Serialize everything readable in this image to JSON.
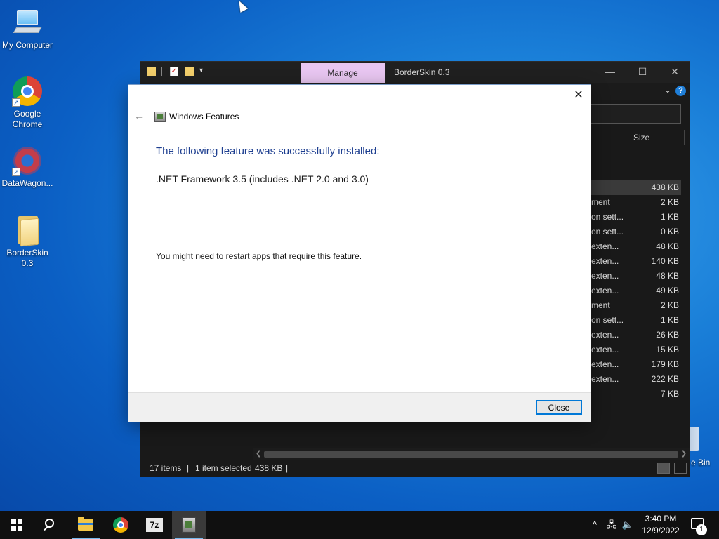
{
  "desktop": {
    "icons": [
      {
        "label": "My Computer",
        "icon": "computer-icon"
      },
      {
        "label": "Google Chrome",
        "icon": "chrome-icon"
      },
      {
        "label": "DataWagon...",
        "icon": "datawagon-icon"
      },
      {
        "label": "BorderSkin 0.3",
        "icon": "folder-icon"
      }
    ],
    "recycle_bin_label": "e Bin"
  },
  "explorer": {
    "manage_tab": "Manage",
    "title": "BorderSkin 0.3",
    "size_header": "Size",
    "rows": [
      {
        "type": "",
        "size": "438 KB",
        "selected": true
      },
      {
        "type": "ment",
        "size": "2 KB"
      },
      {
        "type": "on sett...",
        "size": "1 KB"
      },
      {
        "type": "on sett...",
        "size": "0 KB"
      },
      {
        "type": "exten...",
        "size": "48 KB"
      },
      {
        "type": "exten...",
        "size": "140 KB"
      },
      {
        "type": "exten...",
        "size": "48 KB"
      },
      {
        "type": "exten...",
        "size": "49 KB"
      },
      {
        "type": "ment",
        "size": "2 KB"
      },
      {
        "type": "on sett...",
        "size": "1 KB"
      },
      {
        "type": "exten...",
        "size": "26 KB"
      },
      {
        "type": "exten...",
        "size": "15 KB"
      },
      {
        "type": "exten...",
        "size": "179 KB"
      },
      {
        "type": "exten...",
        "size": "222 KB"
      },
      {
        "type": "",
        "size": "7 KB"
      }
    ],
    "status": {
      "items": "17 items",
      "selected": "1 item selected",
      "selected_size": "438 KB"
    }
  },
  "dialog": {
    "title": "Windows Features",
    "heading": "The following feature was successfully installed:",
    "feature": ".NET Framework 3.5 (includes .NET 2.0 and 3.0)",
    "note": "You might need to restart apps that require this feature.",
    "close_button": "Close",
    "heading_color": "#1e3f90"
  },
  "taskbar": {
    "apps": [
      {
        "name": "file-explorer",
        "icon": "folder-icon"
      },
      {
        "name": "google-chrome",
        "icon": "chrome-icon"
      },
      {
        "name": "7-zip",
        "icon": "7zip-icon",
        "label": "7z"
      },
      {
        "name": "windows-features",
        "icon": "windows-features-icon",
        "active": true
      }
    ],
    "clock_time": "3:40 PM",
    "clock_date": "12/9/2022",
    "notification_count": "1",
    "accent": "#76b9ed"
  }
}
